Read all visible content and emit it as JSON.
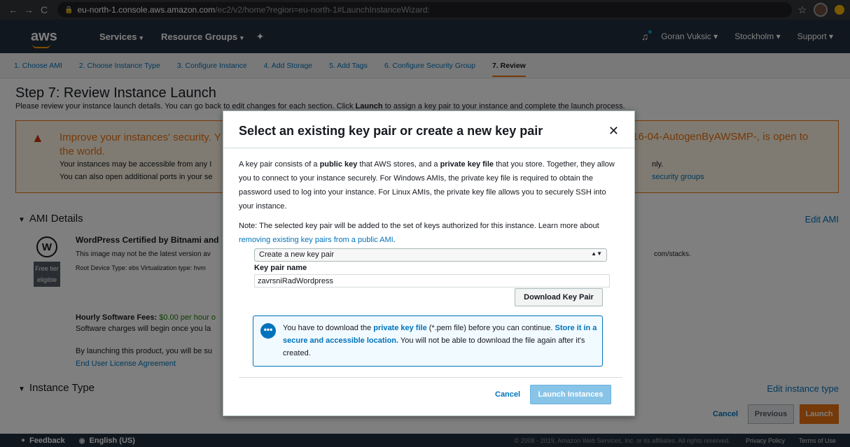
{
  "browser": {
    "url_host": "eu-north-1.console.aws.amazon.com",
    "url_path": "/ec2/v2/home?region=eu-north-1#LaunchInstanceWizard:"
  },
  "aws_nav": {
    "logo": "aws",
    "services": "Services",
    "resource_groups": "Resource Groups",
    "user": "Goran Vuksic",
    "region": "Stockholm",
    "support": "Support"
  },
  "steps": [
    "1. Choose AMI",
    "2. Choose Instance Type",
    "3. Configure Instance",
    "4. Add Storage",
    "5. Add Tags",
    "6. Configure Security Group",
    "7. Review"
  ],
  "page": {
    "title": "Step 7: Review Instance Launch",
    "subtitle_pre": "Please review your instance launch details. You can go back to edit changes for each section. Click ",
    "subtitle_bold": "Launch",
    "subtitle_post": " to assign a key pair to your instance and complete the launch process."
  },
  "warning": {
    "title_left": "Improve your instances' security. Y",
    "title_left2": "the world.",
    "title_right": "16-04-AutogenByAWSMP-, is open to",
    "line1": "Your instances may be accessible from any I",
    "line2": "You can also open additional ports in your se",
    "line1_right": "nly.",
    "line2_right": "security groups"
  },
  "ami": {
    "section": "AMI Details",
    "edit": "Edit AMI",
    "name": "WordPress Certified by Bitnami and",
    "desc": "This image may not be the latest version av",
    "desc_right": "com/stacks.",
    "meta": "Root Device Type: ebs    Virtualization type: hvm",
    "free_tier_1": "Free tier",
    "free_tier_2": "eligible",
    "fees_label": "Hourly Software Fees:",
    "fees_value": "$0.00 per hour o",
    "fees_line2": "Software charges will begin once you la",
    "fees_line3": "By launching this product, you will be su",
    "eula": "End User License Agreement"
  },
  "instance_type": {
    "section": "Instance Type",
    "edit": "Edit instance type"
  },
  "bottom_buttons": {
    "cancel": "Cancel",
    "previous": "Previous",
    "launch": "Launch"
  },
  "footer": {
    "feedback": "Feedback",
    "language": "English (US)",
    "copyright": "© 2008 - 2019, Amazon Web Services, Inc. or its affiliates. All rights reserved.",
    "privacy": "Privacy Policy",
    "terms": "Terms of Use"
  },
  "modal": {
    "title": "Select an existing key pair or create a new key pair",
    "p1_a": "A key pair consists of a ",
    "p1_b": "public key",
    "p1_c": " that AWS stores, and a ",
    "p1_d": "private key file",
    "p1_e": " that you store. Together, they allow you to connect to your instance securely. For Windows AMIs, the private key file is required to obtain the password used to log into your instance. For Linux AMIs, the private key file allows you to securely SSH into your instance.",
    "p2_a": "Note: The selected key pair will be added to the set of keys authorized for this instance. Learn more about ",
    "p2_link": "removing existing key pairs from a public AMI",
    "p2_b": ".",
    "select_value": "Create a new key pair",
    "kp_label": "Key pair name",
    "kp_value": "zavrsniRadWordpress",
    "download": "Download Key Pair",
    "info_a": "You have to download the ",
    "info_b": "private key file",
    "info_c": " (*.pem file) before you can continue. ",
    "info_d": "Store it in a secure and accessible location.",
    "info_e": " You will not be able to download the file again after it's created.",
    "cancel": "Cancel",
    "launch": "Launch Instances"
  }
}
